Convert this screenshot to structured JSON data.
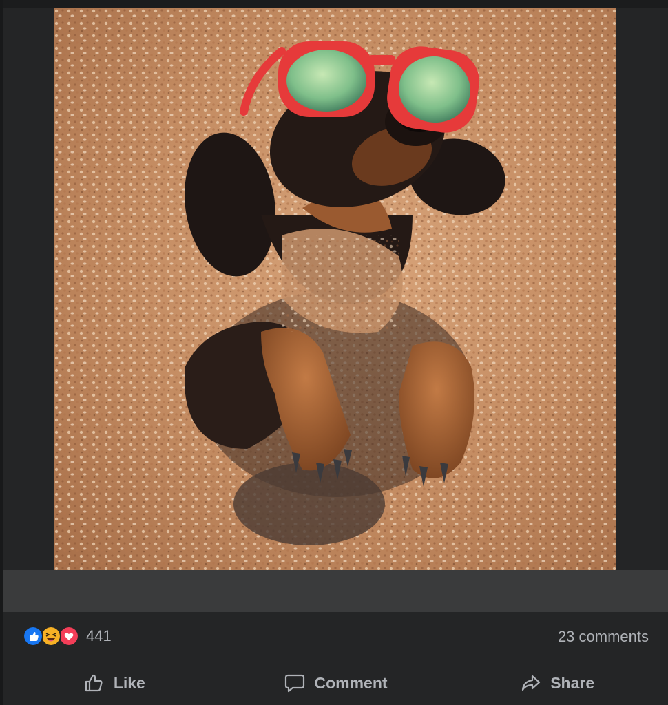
{
  "post": {
    "photo": {
      "alt_subject": "dachshund-in-sand-with-sunglasses"
    },
    "reactions": {
      "icons": [
        "like-reaction-icon",
        "haha-reaction-icon",
        "love-reaction-icon"
      ],
      "count": "441"
    },
    "comments_label": "23 comments",
    "actions": {
      "like_label": "Like",
      "comment_label": "Comment",
      "share_label": "Share"
    },
    "colors": {
      "background": "#242526",
      "muted_text": "#b0b3b8",
      "like_blue": "#1877f2",
      "love_red": "#f33e58",
      "haha_yellow": "#f7b125",
      "sunglasses_red": "#e63a3a"
    }
  }
}
